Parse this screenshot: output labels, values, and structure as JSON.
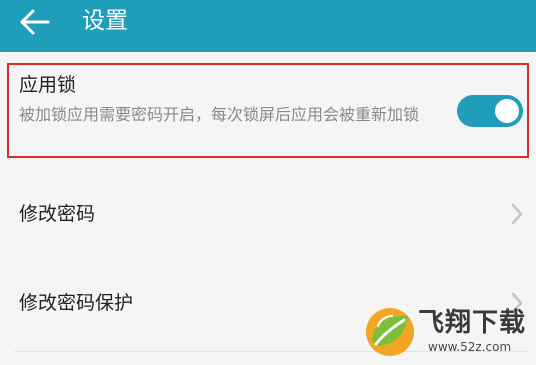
{
  "header": {
    "title": "设置",
    "back_icon": "back-arrow-icon"
  },
  "app_lock": {
    "title": "应用锁",
    "description": "被加锁应用需要密码开启，每次锁屏后应用会被重新加锁",
    "enabled": true
  },
  "settings_items": [
    {
      "label": "修改密码",
      "icon": "chevron-right-icon"
    },
    {
      "label": "修改密码保护",
      "icon": "chevron-right-icon"
    }
  ],
  "watermark": {
    "brand": "飞翔下载",
    "url": "www.52z.com"
  },
  "colors": {
    "accent": "#1f9dbb",
    "highlight": "#e02b2b",
    "background": "#f5f5f5",
    "title_text": "#222222",
    "secondary_text": "#8a8a8a"
  }
}
